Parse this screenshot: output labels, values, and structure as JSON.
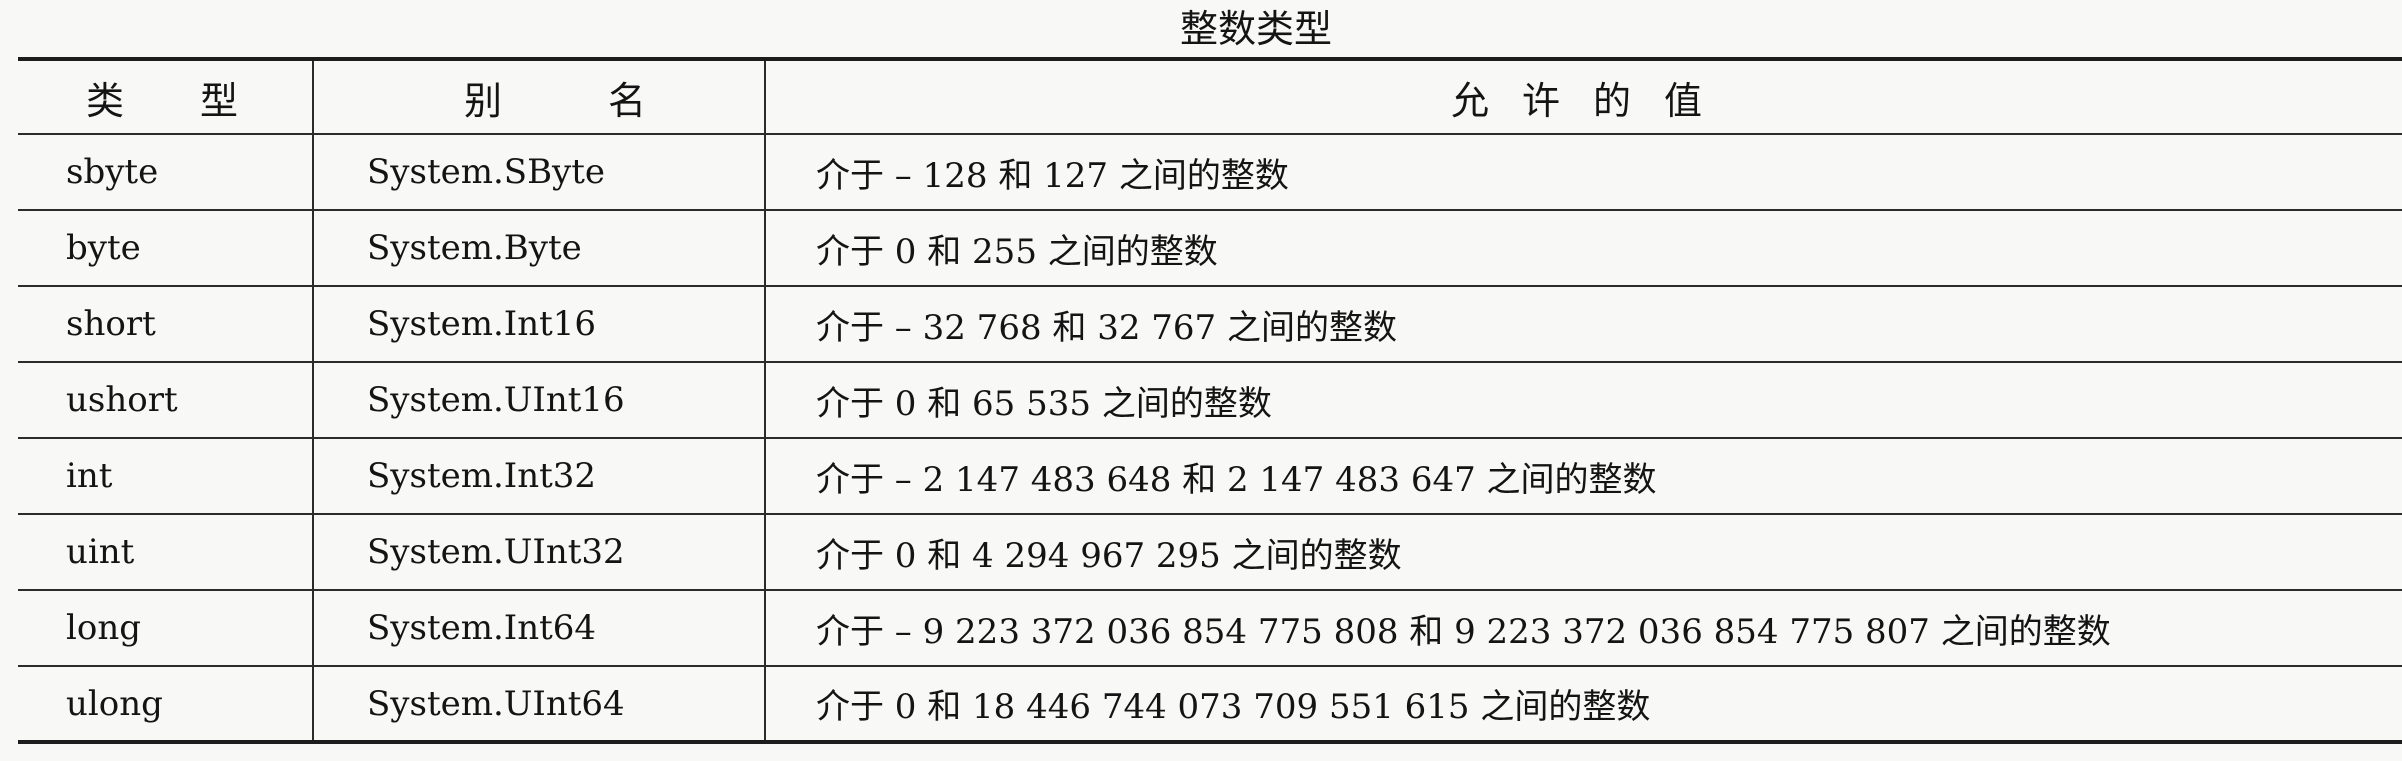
{
  "caption": "整数类型",
  "headers": {
    "type": [
      "类",
      "型"
    ],
    "alias": [
      "别",
      "名"
    ],
    "allowed": [
      "允",
      "许",
      "的",
      "值"
    ]
  },
  "rows": [
    {
      "type": "sbyte",
      "alias": "System.SByte",
      "range": "介于 – 128 和 127 之间的整数"
    },
    {
      "type": "byte",
      "alias": "System.Byte",
      "range": "介于 0 和 255 之间的整数"
    },
    {
      "type": "short",
      "alias": "System.Int16",
      "range": "介于 – 32 768 和 32 767 之间的整数"
    },
    {
      "type": "ushort",
      "alias": "System.UInt16",
      "range": "介于 0  和 65 535 之间的整数"
    },
    {
      "type": "int",
      "alias": "System.Int32",
      "range": "介于 – 2 147 483 648 和  2 147 483 647 之间的整数"
    },
    {
      "type": "uint",
      "alias": "System.UInt32",
      "range": "介于 0 和 4 294 967 295 之间的整数"
    },
    {
      "type": "long",
      "alias": "System.Int64",
      "range": "介于 – 9 223 372 036 854 775 808 和 9 223 372 036 854 775 807 之间的整数"
    },
    {
      "type": "ulong",
      "alias": "System.UInt64",
      "range": "介于 0 和 18 446 744 073 709 551 615 之间的整数"
    }
  ]
}
